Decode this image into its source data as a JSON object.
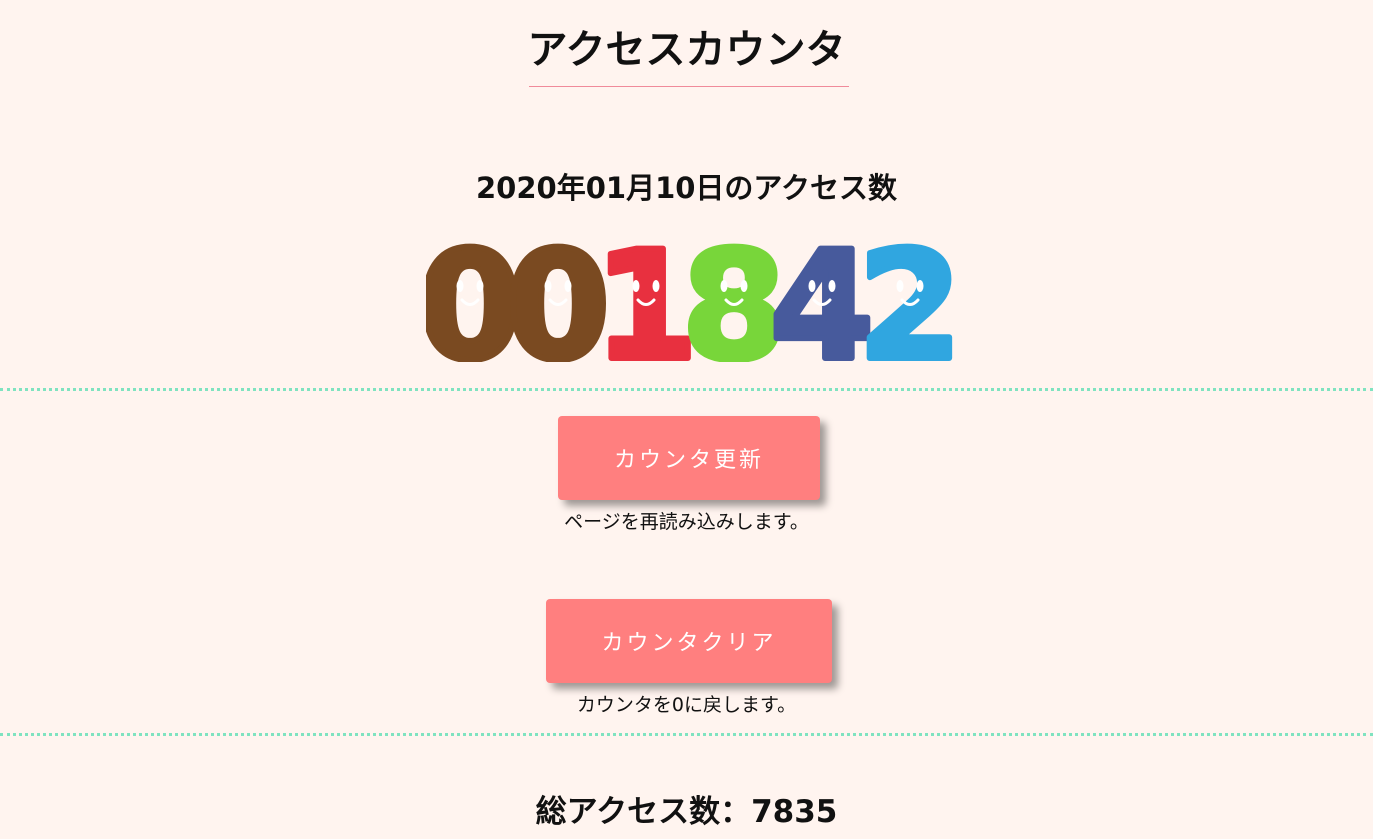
{
  "header": {
    "title": "アクセスカウンタ"
  },
  "counter": {
    "date_heading": "2020年01月10日のアクセス数",
    "digits": [
      {
        "char": "0",
        "color": "#7a4a21"
      },
      {
        "char": "0",
        "color": "#7a4a21"
      },
      {
        "char": "1",
        "color": "#e8303f"
      },
      {
        "char": "8",
        "color": "#78d63a"
      },
      {
        "char": "4",
        "color": "#475a9c"
      },
      {
        "char": "2",
        "color": "#30a6e0"
      }
    ],
    "face_icon": "smiley-face-icon"
  },
  "actions": {
    "refresh_label": "カウンタ更新",
    "refresh_note": "ページを再読み込みします。",
    "clear_label": "カウンタクリア",
    "clear_note": "カウンタを0に戻します。"
  },
  "summary": {
    "total_text": "総アクセス数：7835"
  },
  "colors": {
    "background": "#fff4ef",
    "button": "#ff7f7f",
    "divider": "#7fe3c0",
    "title_underline": "#f08a9a"
  }
}
